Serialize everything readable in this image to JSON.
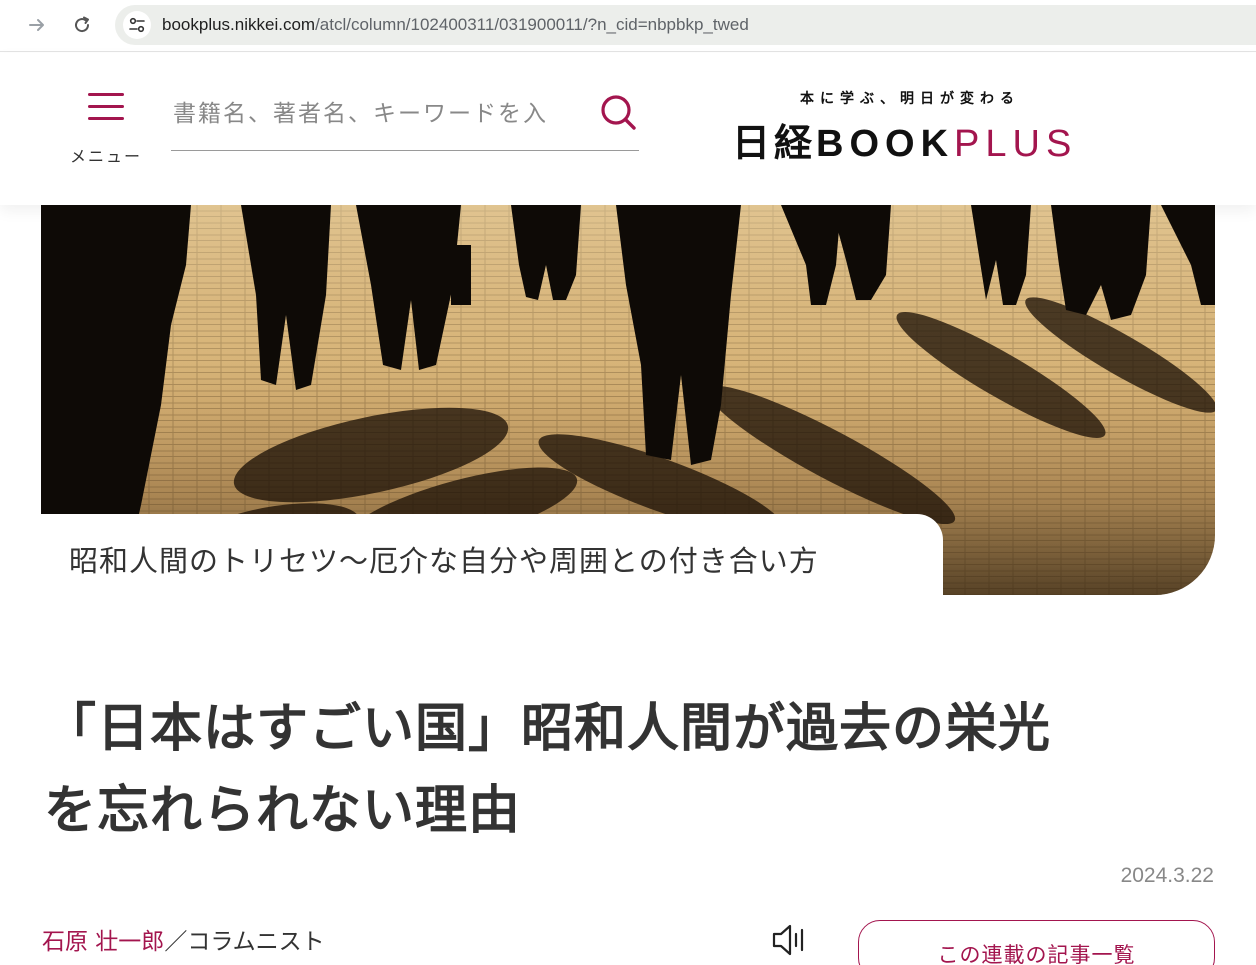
{
  "browser": {
    "url_host": "bookplus.nikkei.com",
    "url_path": "/atcl/column/102400311/031900011/?n_cid=nbpbkp_twed"
  },
  "header": {
    "menu_label": "メニュー",
    "search_placeholder": "書籍名、著者名、キーワードを入",
    "logo_tagline": "本に学ぶ、明日が変わる",
    "logo_nikkei": "日経",
    "logo_book": "BOOK",
    "logo_plus": "PLUS"
  },
  "hero": {
    "series_title": "昭和人間のトリセツ〜厄介な自分や周囲との付き合い方"
  },
  "article": {
    "title_line1": "「日本はすごい国」昭和人間が過去の栄光",
    "title_line2": "を忘れられない理由",
    "date": "2024.3.22",
    "author_name": "石原 壮一郎",
    "author_sep": "／",
    "author_role": "コラムニスト",
    "series_list_label": "この連載の記事一覧"
  },
  "colors": {
    "accent": "#a3154e",
    "text": "#333333",
    "muted": "#888888"
  },
  "icons": {
    "forward": "arrow-right-icon",
    "reload": "reload-icon",
    "site_info": "tune-icon",
    "menu": "hamburger-icon",
    "search": "search-icon",
    "audio": "speaker-icon"
  }
}
